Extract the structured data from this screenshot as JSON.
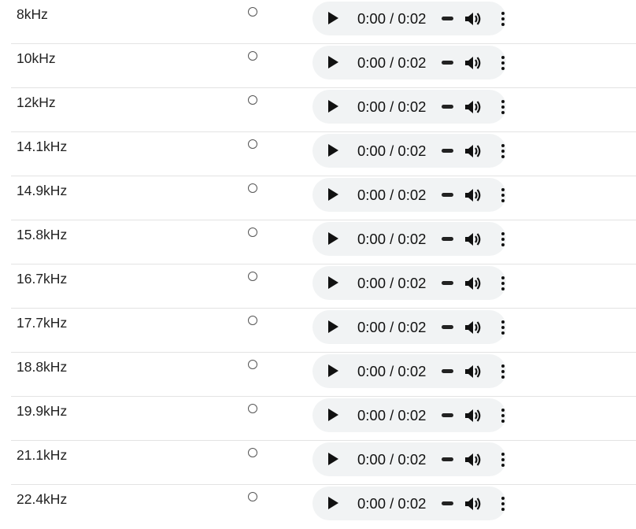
{
  "rows": [
    {
      "frequency": "8kHz",
      "time": "0:00 / 0:02"
    },
    {
      "frequency": "10kHz",
      "time": "0:00 / 0:02"
    },
    {
      "frequency": "12kHz",
      "time": "0:00 / 0:02"
    },
    {
      "frequency": "14.1kHz",
      "time": "0:00 / 0:02"
    },
    {
      "frequency": "14.9kHz",
      "time": "0:00 / 0:02"
    },
    {
      "frequency": "15.8kHz",
      "time": "0:00 / 0:02"
    },
    {
      "frequency": "16.7kHz",
      "time": "0:00 / 0:02"
    },
    {
      "frequency": "17.7kHz",
      "time": "0:00 / 0:02"
    },
    {
      "frequency": "18.8kHz",
      "time": "0:00 / 0:02"
    },
    {
      "frequency": "19.9kHz",
      "time": "0:00 / 0:02"
    },
    {
      "frequency": "21.1kHz",
      "time": "0:00 / 0:02"
    },
    {
      "frequency": "22.4kHz",
      "time": "0:00 / 0:02"
    }
  ],
  "player": {
    "play_icon": "play-icon",
    "volume_icon": "speaker-volume-icon",
    "menu_icon": "more-vertical-icon",
    "background_color": "#f1f3f4"
  },
  "radio": {
    "selected_index": null
  }
}
